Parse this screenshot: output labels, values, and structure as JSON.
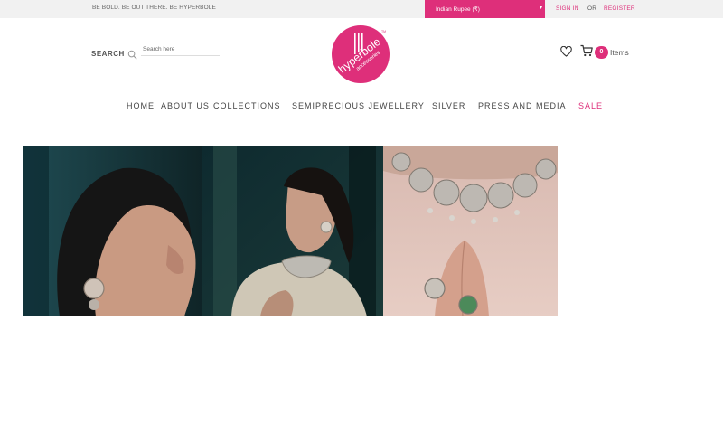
{
  "topbar": {
    "tagline": "BE BOLD. BE OUT THERE. BE HYPERBOLE",
    "currency": "Indian Rupee (₹)",
    "signin": "SIGN IN",
    "or": "OR",
    "register": "REGISTER"
  },
  "header": {
    "search_label": "SEARCH",
    "search_placeholder": "Search here",
    "logo_text": "hyperbole",
    "logo_subtext": "accessories",
    "logo_tm": "TM",
    "cart_count": "0",
    "cart_label": "Items"
  },
  "nav": {
    "home": "HOME",
    "about": "ABOUT US",
    "collections": "COLLECTIONS",
    "semiprecious": "SEMIPRECIOUS JEWELLERY",
    "silver": "SILVER",
    "press": "PRESS AND MEDIA",
    "sale": "SALE"
  },
  "colors": {
    "brand": "#de2f7a",
    "topbar_bg": "#f1f1f1"
  },
  "icons": [
    "search-icon",
    "heart-icon",
    "cart-icon",
    "chevron-down-icon"
  ]
}
